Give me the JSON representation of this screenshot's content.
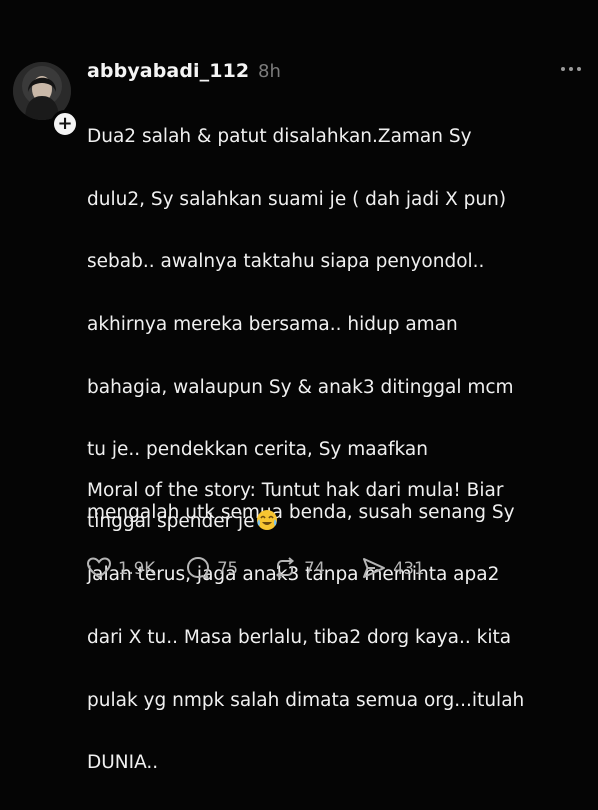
{
  "post": {
    "username": "abbyabadi_112",
    "time": "8h",
    "more_label": "...",
    "follow_badge": "+",
    "body_lines": [
      "Dua2 salah & patut disalahkan.Zaman Sy",
      "dulu2, Sy salahkan suami je ( dah jadi X pun)",
      "sebab.. awalnya taktahu siapa penyondol..",
      "akhirnya mereka bersama.. hidup aman",
      "bahagia, walaupun Sy & anak3 ditinggal mcm",
      "tu je.. pendekkan cerita, Sy maafkan",
      "mengalah utk semua benda, susah senang Sy",
      "jalan terus, jaga anak3 tanpa meminta apa2",
      "dari X tu.. Masa berlalu, tiba2 dorg kaya.. kita",
      "pulak yg nmpk salah dimata semua org...itulah",
      "DUNIA.."
    ],
    "moral_line1": "Moral of the story: Tuntut hak dari mula! Biar",
    "moral_line2": "tinggal spender je",
    "moral_emoji": "crying-laughing-emoji"
  },
  "actions": {
    "likes": "1.9K",
    "comments": "75",
    "reposts": "74",
    "shares": "431"
  },
  "colors": {
    "background": "#050505",
    "text": "#f0f0f0",
    "muted": "#7b7b7b",
    "icons": "#b5b5b5"
  }
}
